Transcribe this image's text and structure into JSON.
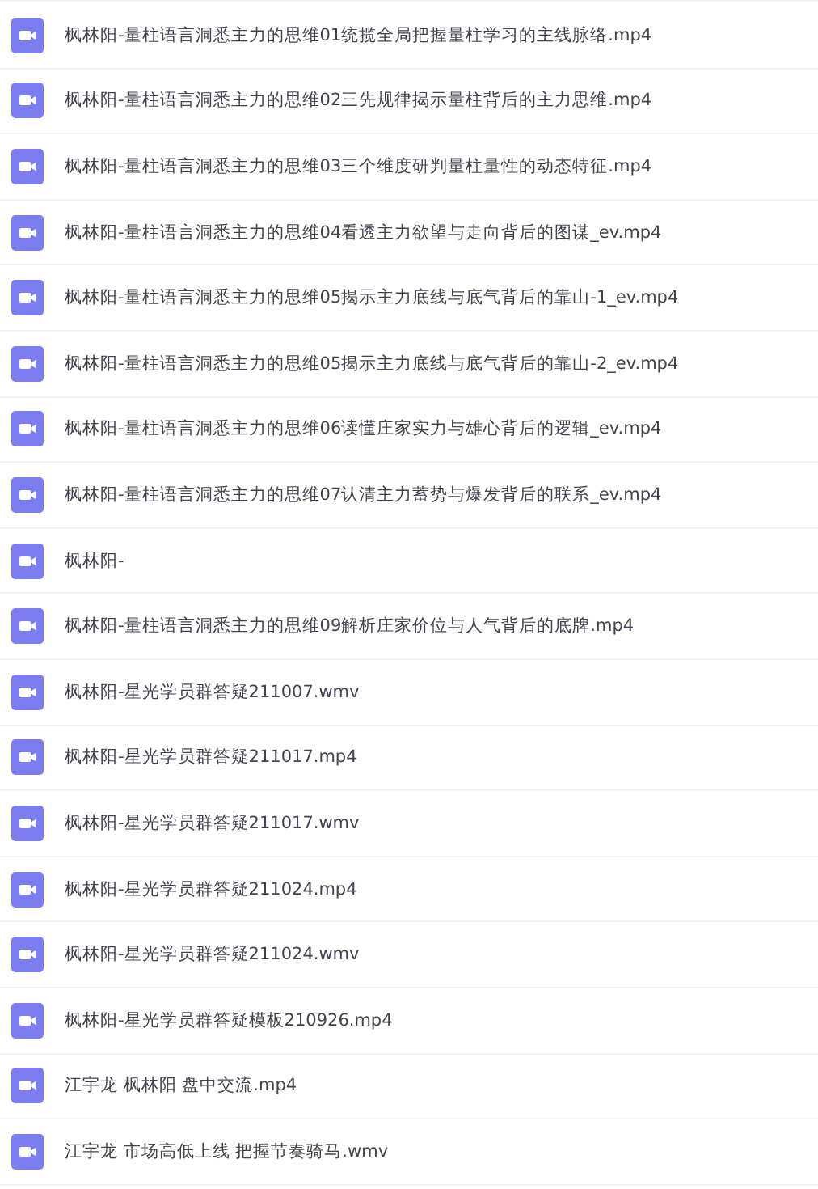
{
  "files": [
    {
      "name": "枫林阳-量柱语言洞悉主力的思维01统揽全局把握量柱学习的主线脉络.mp4"
    },
    {
      "name": "枫林阳-量柱语言洞悉主力的思维02三先规律揭示量柱背后的主力思维.mp4"
    },
    {
      "name": "枫林阳-量柱语言洞悉主力的思维03三个维度研判量柱量性的动态特征.mp4"
    },
    {
      "name": "枫林阳-量柱语言洞悉主力的思维04看透主力欲望与走向背后的图谋_ev.mp4"
    },
    {
      "name": "枫林阳-量柱语言洞悉主力的思维05揭示主力底线与底气背后的靠山-1_ev.mp4"
    },
    {
      "name": "枫林阳-量柱语言洞悉主力的思维05揭示主力底线与底气背后的靠山-2_ev.mp4"
    },
    {
      "name": "枫林阳-量柱语言洞悉主力的思维06读懂庄家实力与雄心背后的逻辑_ev.mp4"
    },
    {
      "name": "枫林阳-量柱语言洞悉主力的思维07认清主力蓄势与爆发背后的联系_ev.mp4"
    },
    {
      "name": "枫林阳-"
    },
    {
      "name": "枫林阳-量柱语言洞悉主力的思维09解析庄家价位与人气背后的底牌.mp4"
    },
    {
      "name": "枫林阳-星光学员群答疑211007.wmv"
    },
    {
      "name": "枫林阳-星光学员群答疑211017.mp4"
    },
    {
      "name": "枫林阳-星光学员群答疑211017.wmv"
    },
    {
      "name": "枫林阳-星光学员群答疑211024.mp4"
    },
    {
      "name": "枫林阳-星光学员群答疑211024.wmv"
    },
    {
      "name": "枫林阳-星光学员群答疑模板210926.mp4"
    },
    {
      "name": "江宇龙 枫林阳 盘中交流.mp4"
    },
    {
      "name": "江宇龙 市场高低上线 把握节奏骑马.wmv"
    }
  ]
}
